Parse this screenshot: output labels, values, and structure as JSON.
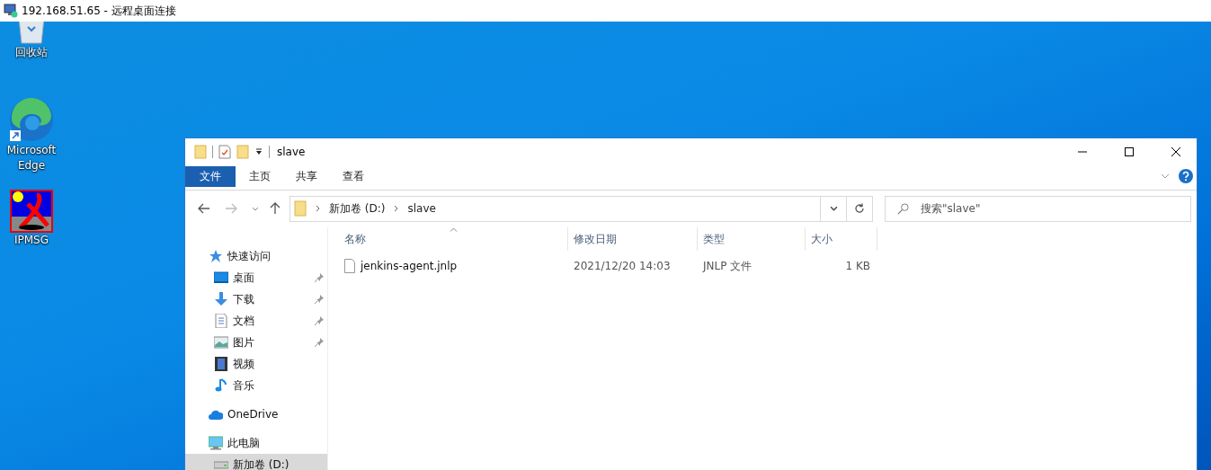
{
  "rdp_title_bar": {
    "title": "192.168.51.65 - 远程桌面连接"
  },
  "desktop_icons": [
    {
      "label": "回收站",
      "kind": "recycle"
    },
    {
      "label": "Microsoft Edge",
      "kind": "edge"
    },
    {
      "label": "IPMSG",
      "kind": "ipmsg"
    }
  ],
  "explorer": {
    "title": "slave",
    "ribbon_tabs": [
      {
        "label": "文件",
        "selected": true
      },
      {
        "label": "主页",
        "selected": false
      },
      {
        "label": "共享",
        "selected": false
      },
      {
        "label": "查看",
        "selected": false
      }
    ],
    "address": {
      "segments": [
        "新加卷 (D:)",
        "slave"
      ]
    },
    "search": {
      "placeholder": "搜索\"slave\""
    },
    "nav_pane": [
      {
        "label": "快速访问",
        "kind": "star",
        "selected": false,
        "children": [
          {
            "label": "桌面",
            "kind": "desktop",
            "pinned": true,
            "selected": false
          },
          {
            "label": "下载",
            "kind": "download",
            "pinned": true,
            "selected": false
          },
          {
            "label": "文档",
            "kind": "document",
            "pinned": true,
            "selected": false
          },
          {
            "label": "图片",
            "kind": "picture",
            "pinned": true,
            "selected": false
          },
          {
            "label": "视频",
            "kind": "video",
            "pinned": false,
            "selected": false
          },
          {
            "label": "音乐",
            "kind": "music",
            "pinned": false,
            "selected": false
          }
        ]
      },
      {
        "label": "OneDrive",
        "kind": "cloud",
        "selected": false
      },
      {
        "label": "此电脑",
        "kind": "pc",
        "selected": false,
        "children": [
          {
            "label": "新加卷 (D:)",
            "kind": "drive",
            "pinned": false,
            "selected": true
          }
        ]
      }
    ],
    "columns": [
      {
        "label": "名称",
        "sorted": true
      },
      {
        "label": "修改日期",
        "sorted": false
      },
      {
        "label": "类型",
        "sorted": false
      },
      {
        "label": "大小",
        "sorted": false
      }
    ],
    "files": [
      {
        "name": "jenkins-agent.jnlp",
        "modified": "2021/12/20 14:03",
        "type": "JNLP 文件",
        "size": "1 KB"
      }
    ]
  }
}
